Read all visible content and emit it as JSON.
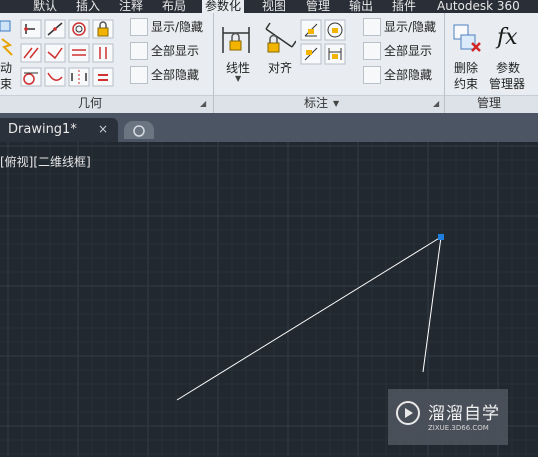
{
  "menu": {
    "tabs": [
      "默认",
      "插入",
      "注释",
      "布局",
      "参数化",
      "视图",
      "管理",
      "输出",
      "插件",
      "Autodesk 360"
    ],
    "active_index": 4
  },
  "ribbon": {
    "auto_constrain_partial": [
      "动",
      "束"
    ],
    "geometric": {
      "show_hide": "显示/隐藏",
      "show_all": "全部显示",
      "hide_all": "全部隐藏",
      "group_label": "几何"
    },
    "dimensional": {
      "linear": "线性",
      "aligned": "对齐",
      "show_hide": "显示/隐藏",
      "show_all": "全部显示",
      "hide_all": "全部隐藏",
      "group_label": "标注"
    },
    "manage": {
      "delete_constraints_1": "删除",
      "delete_constraints_2": "约束",
      "params_manager_1": "参数",
      "params_manager_2": "管理器",
      "fx": "fx",
      "group_label": "管理"
    }
  },
  "tabs": {
    "document": "Drawing1*",
    "close_glyph": "×"
  },
  "viewport": {
    "label": "[俯视][二维线框]"
  },
  "colors": {
    "canvas_bg": "#212830",
    "grid_minor": "#283039",
    "grid_major": "#333c47",
    "line": "#ffffff",
    "grip": "#1e7fe0"
  },
  "watermark": {
    "title": "溜溜自学",
    "url": "ZIXUE.3D66.COM"
  }
}
